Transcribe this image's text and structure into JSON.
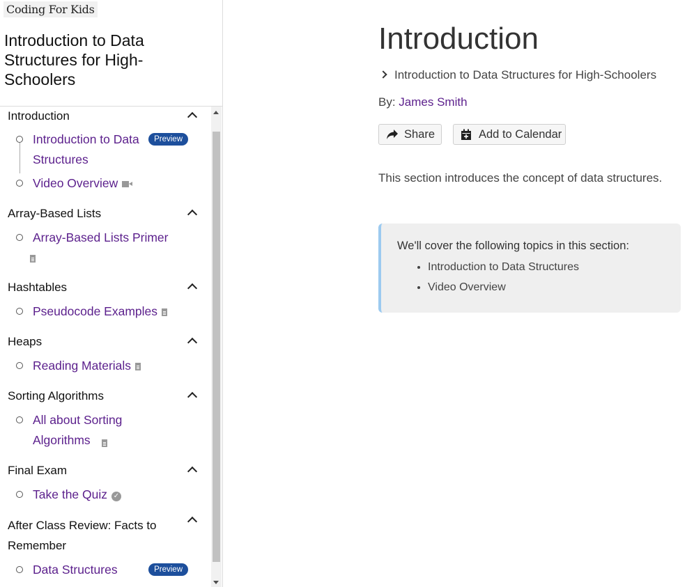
{
  "sidebar": {
    "logo": "Coding For Kids",
    "course_title": "Introduction to Data Structures for High-Schoolers",
    "sections": [
      {
        "title": "Introduction",
        "items": [
          {
            "label": "Introduction to Data Structures",
            "badge": "Preview",
            "icon": ""
          },
          {
            "label": "Video Overview",
            "badge": "",
            "icon": "video-icon"
          }
        ]
      },
      {
        "title": "Array-Based Lists",
        "items": [
          {
            "label": "Array-Based Lists Primer",
            "badge": "",
            "icon": "document-icon"
          }
        ]
      },
      {
        "title": "Hashtables",
        "items": [
          {
            "label": "Pseudocode Examples",
            "badge": "",
            "icon": "document-icon"
          }
        ]
      },
      {
        "title": "Heaps",
        "items": [
          {
            "label": "Reading Materials",
            "badge": "",
            "icon": "document-icon"
          }
        ]
      },
      {
        "title": "Sorting Algorithms",
        "items": [
          {
            "label": "All about Sorting Algorithms",
            "badge": "",
            "icon": "document-icon"
          }
        ]
      },
      {
        "title": "Final Exam",
        "items": [
          {
            "label": "Take the Quiz",
            "badge": "",
            "icon": "check-circle-icon"
          }
        ]
      },
      {
        "title": "After Class Review: Facts to Remember",
        "items": [
          {
            "label": "Data Structures",
            "badge": "Preview",
            "icon": ""
          }
        ]
      }
    ]
  },
  "main": {
    "title": "Introduction",
    "breadcrumb": "Introduction to Data Structures for High-Schoolers",
    "byline_prefix": "By: ",
    "author": "James Smith",
    "share_label": "Share",
    "calendar_label": "Add to Calendar",
    "description": "This section introduces the concept of data structures.",
    "callout": {
      "title": "We'll cover the following topics in this section:",
      "topics": [
        "Introduction to Data Structures",
        "Video Overview"
      ]
    }
  },
  "colors": {
    "link": "#5b1f8c",
    "badge": "#1d4f9c",
    "callout_border": "#9ccaf0"
  }
}
